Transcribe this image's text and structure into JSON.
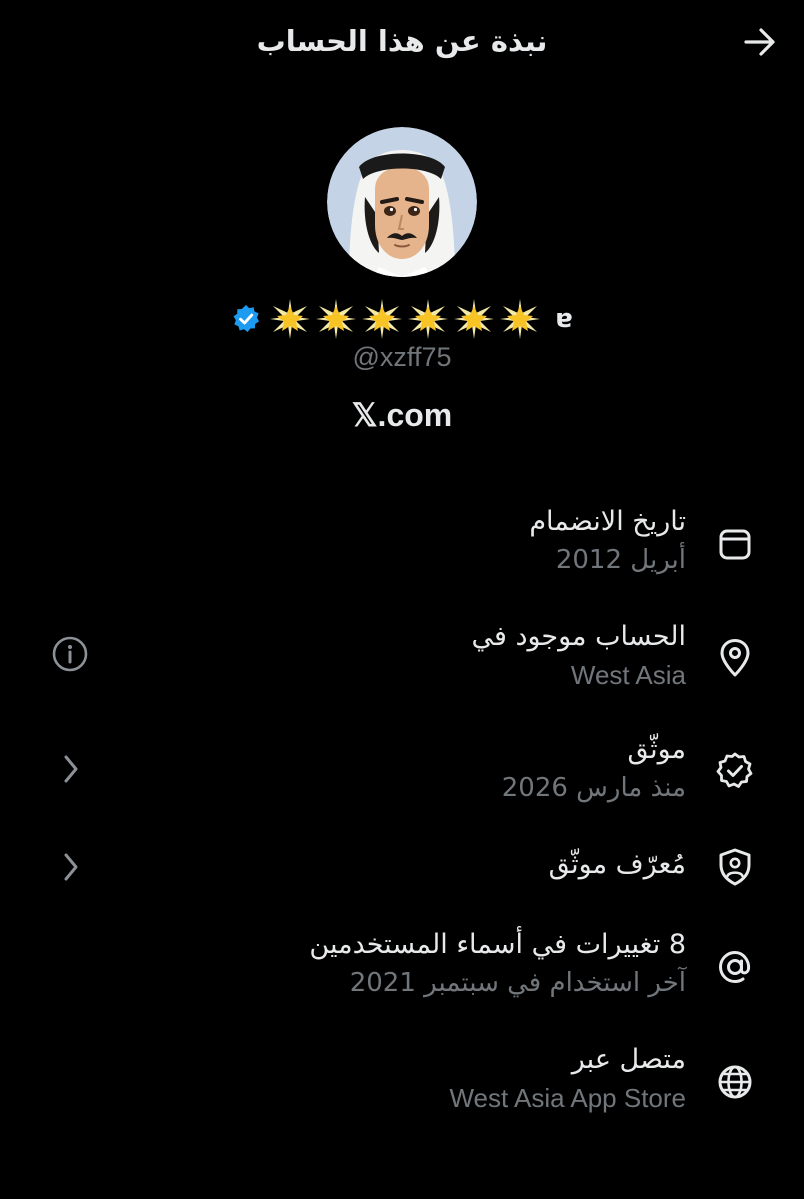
{
  "header": {
    "title": "نبذة عن هذا الحساب",
    "back_icon": "arrow-right-icon"
  },
  "profile": {
    "avatar_icon": "avatar-illustration",
    "verified_icon": "verified-badge-icon",
    "star_icon": "glowing-star-emoji",
    "star_count": 6,
    "name_suffix_glyph": "ɐ",
    "handle": "@xzff75",
    "website": "𝕏.com"
  },
  "rows": [
    {
      "label": "تاريخ الانضمام",
      "value": "أبريل 2012",
      "icon": "calendar-icon"
    },
    {
      "label": "الحساب موجود في",
      "value": "West Asia",
      "icon": "location-pin-icon",
      "aside_icon": "info-icon"
    },
    {
      "label": "موثّق",
      "value": "منذ مارس 2026",
      "icon": "verified-seal-icon",
      "aside_icon": "chevron-left-icon"
    },
    {
      "label": "مُعرّف موثّق",
      "value": "",
      "icon": "id-shield-icon",
      "aside_icon": "chevron-left-icon"
    },
    {
      "label": "8 تغييرات في أسماء المستخدمين",
      "value": "آخر استخدام في سبتمبر 2021",
      "icon": "at-sign-icon"
    },
    {
      "label": "متصل عبر",
      "value": "West Asia App Store",
      "icon": "globe-icon"
    }
  ],
  "colors": {
    "background": "#000000",
    "primary_text": "#e7e9ea",
    "secondary_text": "#71767b",
    "verified_blue": "#1d9bf0",
    "star_gold": "#f7c325"
  }
}
